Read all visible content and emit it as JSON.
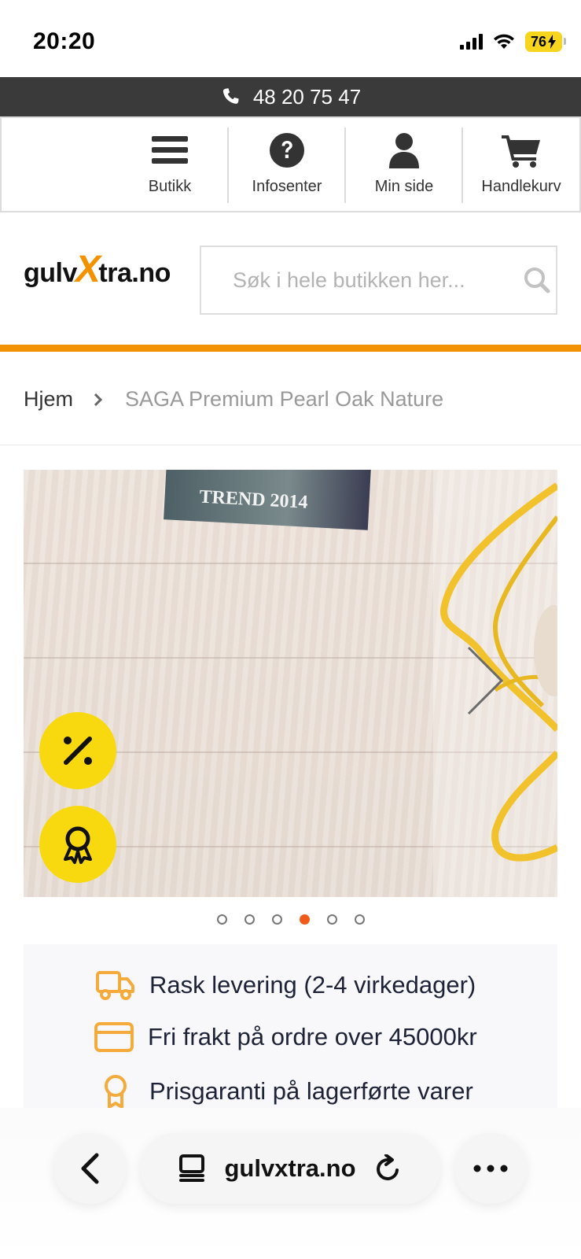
{
  "status_bar": {
    "time": "20:20",
    "battery": "76"
  },
  "top_bar": {
    "phone": "48 20 75 47"
  },
  "nav": {
    "items": [
      {
        "label": "Butikk",
        "icon": "menu-icon"
      },
      {
        "label": "Infosenter",
        "icon": "question-icon"
      },
      {
        "label": "Min side",
        "icon": "user-icon"
      },
      {
        "label": "Handlekurv",
        "icon": "cart-icon"
      }
    ]
  },
  "header": {
    "logo_prefix": "gulv",
    "logo_x": "X",
    "logo_suffix": "tra.no",
    "search_placeholder": "Søk i hele butikken her..."
  },
  "breadcrumb": {
    "home": "Hjem",
    "current": "SAGA Premium Pearl Oak Nature"
  },
  "gallery": {
    "magazine_text": "TREND 2014",
    "slide_count": 6,
    "active_index": 3,
    "badges": [
      "discount-icon",
      "award-icon"
    ]
  },
  "benefits": [
    {
      "text": "Rask levering (2-4 virkedager)",
      "icon": "truck-icon"
    },
    {
      "text": "Fri frakt på ordre over 45000kr",
      "icon": "card-icon"
    },
    {
      "text": "Prisgaranti på lagerførte varer",
      "icon": "award-icon"
    }
  ],
  "browser": {
    "url": "gulvxtra.no"
  },
  "colors": {
    "accent": "#f39200",
    "badge": "#f8d90f",
    "active_dot": "#f05a1a",
    "dark_bar": "#3a3a3a"
  }
}
